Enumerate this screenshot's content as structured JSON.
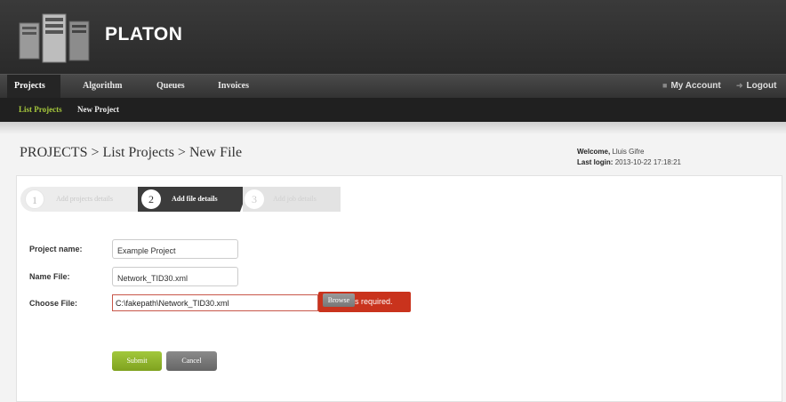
{
  "header": {
    "brand": "PLATON"
  },
  "topnav": {
    "items": [
      "Projects",
      "Algorithm",
      "Queues",
      "Invoices"
    ],
    "my_account": "My Account",
    "logout": "Logout"
  },
  "subnav": {
    "items": [
      "List Projects",
      "New Project"
    ]
  },
  "breadcrumb": "PROJECTS > List Projects > New File",
  "welcome": {
    "label": "Welcome,",
    "user": "Lluis Gifre",
    "last_login_label": "Last login:",
    "last_login": "2013-10-22 17:18:21"
  },
  "steps": [
    {
      "num": "1",
      "label": "Add projects details"
    },
    {
      "num": "2",
      "label": "Add file details"
    },
    {
      "num": "3",
      "label": "Add job details"
    }
  ],
  "form": {
    "project_name_label": "Project name:",
    "project_name_value": "Example Project",
    "name_file_label": "Name File:",
    "name_file_value": "Network_TID30.xml",
    "choose_file_label": "Choose File:",
    "choose_file_value": "C:\\fakepath\\Network_TID30.xml",
    "browse_label": "Browse",
    "error_text": "s required.",
    "submit_label": "Submit",
    "cancel_label": "Cancel"
  },
  "colors": {
    "accent_green": "#8fb42a",
    "error_red": "#c9331d",
    "header_dark": "#2e2e2e"
  }
}
